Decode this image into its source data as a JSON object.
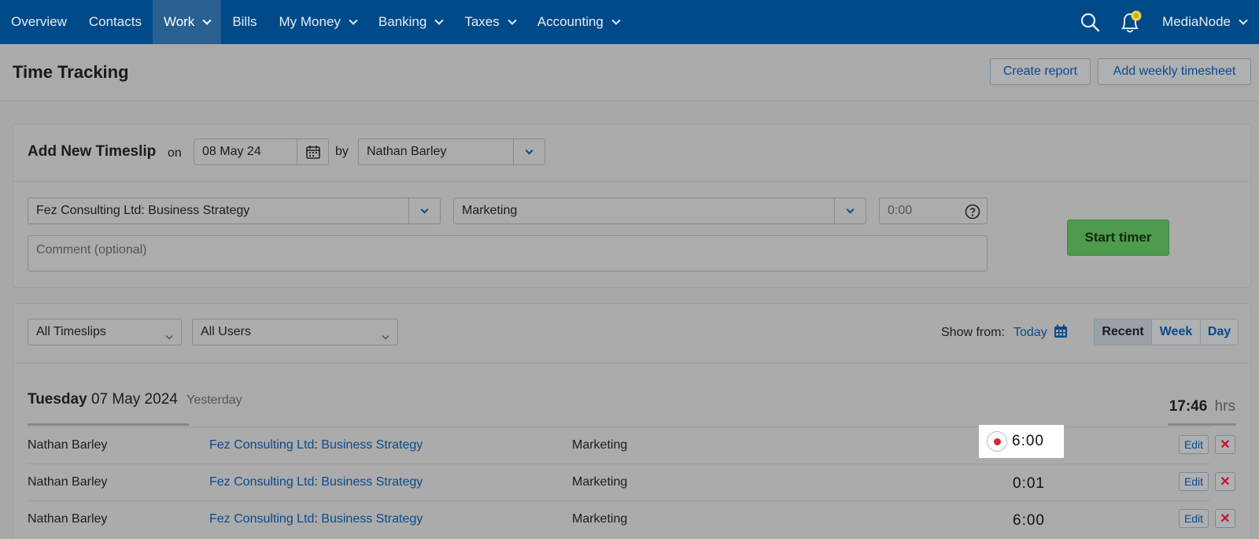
{
  "nav": {
    "items": [
      {
        "label": "Overview",
        "dropdown": false
      },
      {
        "label": "Contacts",
        "dropdown": false
      },
      {
        "label": "Work",
        "dropdown": true,
        "active": true
      },
      {
        "label": "Bills",
        "dropdown": false
      },
      {
        "label": "My Money",
        "dropdown": true
      },
      {
        "label": "Banking",
        "dropdown": true
      },
      {
        "label": "Taxes",
        "dropdown": true
      },
      {
        "label": "Accounting",
        "dropdown": true
      }
    ],
    "account_label": "MediaNode"
  },
  "page": {
    "title": "Time Tracking",
    "create_report": "Create report",
    "add_weekly_timesheet": "Add weekly timesheet"
  },
  "new_timeslip": {
    "title": "Add New Timeslip",
    "on_label": "on",
    "date": "08 May 24",
    "by_label": "by",
    "user": "Nathan Barley",
    "project": "Fez Consulting Ltd: Business Strategy",
    "task": "Marketing",
    "hours_placeholder": "0:00",
    "comment_placeholder": "Comment (optional)",
    "start_timer": "Start timer"
  },
  "filters": {
    "timeslips": "All Timeslips",
    "users": "All Users",
    "show_from_label": "Show from:",
    "show_from_value": "Today",
    "views": [
      {
        "label": "Recent",
        "active": true
      },
      {
        "label": "Week",
        "active": false
      },
      {
        "label": "Day",
        "active": false
      }
    ]
  },
  "day": {
    "weekday": "Tuesday",
    "date": "07 May 2024",
    "relative": "Yesterday",
    "total": "17:46",
    "total_unit": "hrs"
  },
  "entries": [
    {
      "user": "Nathan Barley",
      "contact": "Fez Consulting Ltd",
      "project": "Business Strategy",
      "task": "Marketing",
      "hours": "6:00",
      "running": true,
      "edit": "Edit",
      "delete": "✕"
    },
    {
      "user": "Nathan Barley",
      "contact": "Fez Consulting Ltd",
      "project": "Business Strategy",
      "task": "Marketing",
      "hours": "0:01",
      "running": false,
      "edit": "Edit",
      "delete": "✕"
    },
    {
      "user": "Nathan Barley",
      "contact": "Fez Consulting Ltd",
      "project": "Business Strategy",
      "task": "Marketing",
      "hours": "6:00",
      "running": false,
      "edit": "Edit",
      "delete": "✕"
    }
  ],
  "colors": {
    "nav_bg": "#004a8a",
    "link": "#0b4a8c",
    "start_timer_bg": "#4e9a4e",
    "delete": "#c8102e",
    "recording_dot": "#d6283c"
  }
}
